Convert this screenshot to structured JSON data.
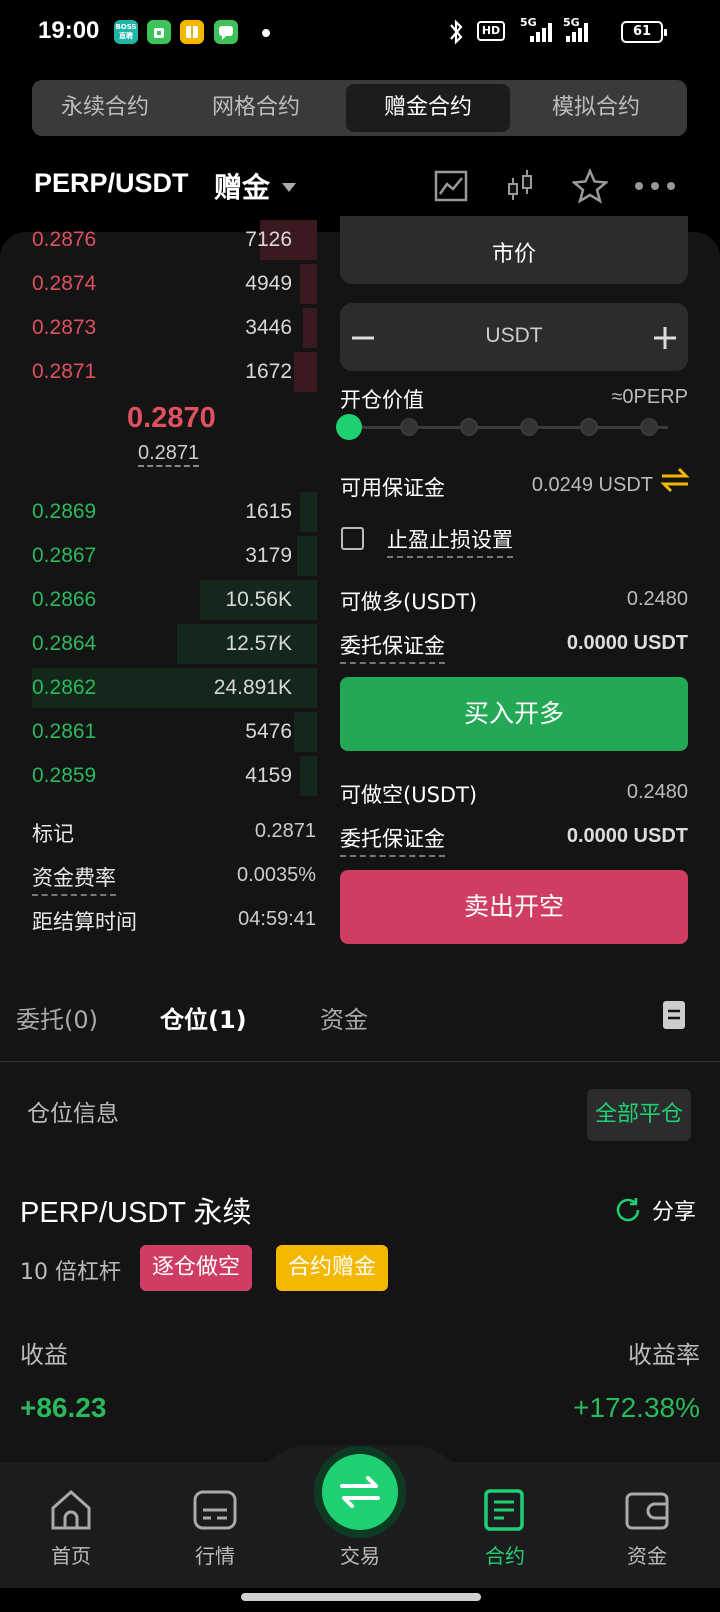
{
  "status": {
    "time": "19:00",
    "battery": "61",
    "net1": "5G",
    "net2": "5G",
    "hd": "HD"
  },
  "app_icons": [
    {
      "name": "boss-app-icon",
      "text": "BOSS\n直聘",
      "color": "#1fb5a8"
    },
    {
      "name": "shop-app-icon",
      "text": "",
      "color": "#3ec25a"
    },
    {
      "name": "notes-app-icon",
      "text": "",
      "color": "#f5b800"
    },
    {
      "name": "chat-app-icon",
      "text": "",
      "color": "#3ec25a"
    }
  ],
  "tabs": [
    "永续合约",
    "网格合约",
    "赠金合约",
    "模拟合约"
  ],
  "header": {
    "pair": "PERP/USDT",
    "tag": "赠金"
  },
  "orderbook": {
    "asks": [
      {
        "price": "0.2876",
        "qty": "7126",
        "depth": 0.2
      },
      {
        "price": "0.2874",
        "qty": "4949",
        "depth": 0.06
      },
      {
        "price": "0.2873",
        "qty": "3446",
        "depth": 0.05
      },
      {
        "price": "0.2871",
        "qty": "1672",
        "depth": 0.08
      }
    ],
    "mid_price": "0.2870",
    "mark_price": "0.2871",
    "bids": [
      {
        "price": "0.2869",
        "qty": "1615",
        "depth": 0.06
      },
      {
        "price": "0.2867",
        "qty": "3179",
        "depth": 0.07
      },
      {
        "price": "0.2866",
        "qty": "10.56K",
        "depth": 0.41
      },
      {
        "price": "0.2864",
        "qty": "12.57K",
        "depth": 0.49
      },
      {
        "price": "0.2862",
        "qty": "24.891K",
        "depth": 1.0
      },
      {
        "price": "0.2861",
        "qty": "5476",
        "depth": 0.08
      },
      {
        "price": "0.2859",
        "qty": "4159",
        "depth": 0.06
      }
    ]
  },
  "info": {
    "mark_label": "标记",
    "mark_val": "0.2871",
    "funding_label": "资金费率",
    "funding_val": "0.0035%",
    "settle_label": "距结算时间",
    "settle_val": "04:59:41"
  },
  "form": {
    "order_type": "市价",
    "amount_unit": "USDT",
    "open_value_label": "开仓价值",
    "open_value": "≈0PERP",
    "slider_level": 0,
    "avail_margin_label": "可用保证金",
    "avail_margin_val": "0.0249 USDT",
    "tpsl_label": "止盈止损设置",
    "long_max_label": "可做多(USDT)",
    "long_max_val": "0.2480",
    "long_margin_label": "委托保证金",
    "long_margin_val": "0.0000 USDT",
    "buy_label": "买入开多",
    "short_max_label": "可做空(USDT)",
    "short_max_val": "0.2480",
    "short_margin_label": "委托保证金",
    "short_margin_val": "0.0000 USDT",
    "sell_label": "卖出开空"
  },
  "position_tabs": [
    "委托(0)",
    "仓位(1)",
    "资金"
  ],
  "position": {
    "section_title": "仓位信息",
    "close_all": "全部平仓",
    "symbol": "PERP/USDT 永续",
    "share": "分享",
    "leverage": "10 倍杠杆",
    "badge_mode": "逐仓做空",
    "badge_bonus": "合约赠金",
    "pnl_label": "收益",
    "pnl_val": "+86.23",
    "roe_label": "收益率",
    "roe_val": "+172.38%"
  },
  "nav": [
    "首页",
    "行情",
    "交易",
    "合约",
    "资金"
  ],
  "colors": {
    "green": "#1fd072",
    "red": "#cf3d63",
    "yellow": "#f5b800"
  }
}
